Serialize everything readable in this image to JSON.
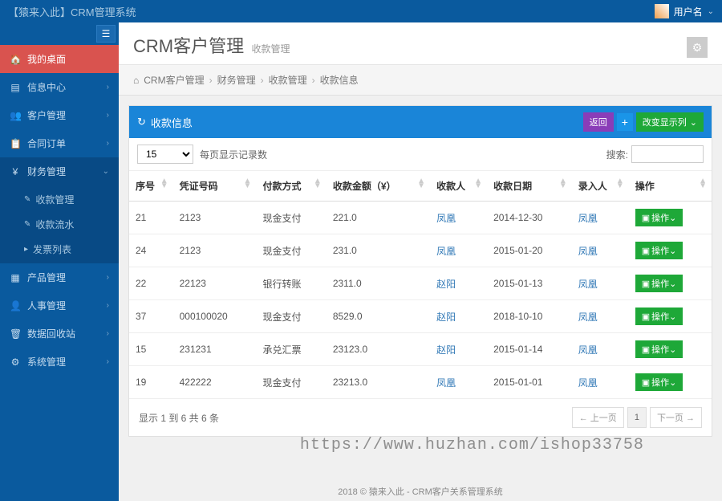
{
  "header": {
    "brand": "【猿来入此】CRM管理系统",
    "username": "用户名"
  },
  "sidebar": {
    "items": [
      {
        "icon": "🏠",
        "label": "我的桌面",
        "active": true
      },
      {
        "icon": "▤",
        "label": "信息中心"
      },
      {
        "icon": "👥",
        "label": "客户管理"
      },
      {
        "icon": "📋",
        "label": "合同订单"
      },
      {
        "icon": "¥",
        "label": "财务管理",
        "expanded": true
      }
    ],
    "subItems": [
      {
        "icon": "✎",
        "label": "收款管理"
      },
      {
        "icon": "✎",
        "label": "收款流水"
      },
      {
        "icon": "▸",
        "label": "发票列表"
      }
    ],
    "itemsAfter": [
      {
        "icon": "▦",
        "label": "产品管理"
      },
      {
        "icon": "👤",
        "label": "人事管理"
      },
      {
        "icon": "🗑",
        "label": "数据回收站"
      },
      {
        "icon": "⚙",
        "label": "系统管理"
      }
    ]
  },
  "page": {
    "title": "CRM客户管理",
    "subtitle": "收款管理"
  },
  "breadcrumb": {
    "items": [
      "CRM客户管理",
      "财务管理",
      "收款管理",
      "收款信息"
    ]
  },
  "panel": {
    "title": "收款信息",
    "returnBtn": "返回",
    "changeColsBtn": "改变显示列"
  },
  "toolbar": {
    "pageSize": "15",
    "pageSizeLabel": "每页显示记录数",
    "searchLabel": "搜索:"
  },
  "table": {
    "headers": [
      "序号",
      "凭证号码",
      "付款方式",
      "收款金额（¥）",
      "收款人",
      "收款日期",
      "录入人",
      "操作"
    ],
    "rows": [
      {
        "no": "21",
        "voucher": "2123",
        "method": "现金支付",
        "amount": "221.0",
        "payee": "凤凰",
        "date": "2014-12-30",
        "entry": "凤凰"
      },
      {
        "no": "24",
        "voucher": "2123",
        "method": "现金支付",
        "amount": "231.0",
        "payee": "凤凰",
        "date": "2015-01-20",
        "entry": "凤凰"
      },
      {
        "no": "22",
        "voucher": "22123",
        "method": "银行转账",
        "amount": "2311.0",
        "payee": "赵阳",
        "date": "2015-01-13",
        "entry": "凤凰"
      },
      {
        "no": "37",
        "voucher": "000100020",
        "method": "现金支付",
        "amount": "8529.0",
        "payee": "赵阳",
        "date": "2018-10-10",
        "entry": "凤凰"
      },
      {
        "no": "15",
        "voucher": "231231",
        "method": "承兑汇票",
        "amount": "23123.0",
        "payee": "赵阳",
        "date": "2015-01-14",
        "entry": "凤凰"
      },
      {
        "no": "19",
        "voucher": "422222",
        "method": "现金支付",
        "amount": "23213.0",
        "payee": "凤凰",
        "date": "2015-01-01",
        "entry": "凤凰"
      }
    ],
    "actionLabel": "操作",
    "summary": "显示 1 到 6 共 6 条",
    "prev": "← 上一页",
    "pageNum": "1",
    "next": "下一页 →"
  },
  "footer": "2018 © 猿来入此 - CRM客户关系管理系统",
  "watermark": "https://www.huzhan.com/ishop33758"
}
